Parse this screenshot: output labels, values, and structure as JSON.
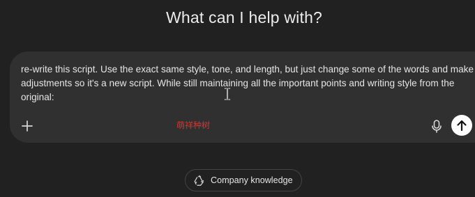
{
  "header": {
    "title": "What can I help with?"
  },
  "composer": {
    "text": "re-write this script. Use the exact same style, tone, and length, but just change some of the words and make adjustments so it's a new script. While still maintaining all the important points and writing style from the original:",
    "attach_icon": "plus-icon",
    "voice_icon": "microphone-icon",
    "send_icon": "arrow-up-icon"
  },
  "watermark": {
    "text": "萌祥种树",
    "color": "#d9332b"
  },
  "suggestion": {
    "label": "Company knowledge",
    "icon": "recycle-icon"
  },
  "colors": {
    "background": "#212121",
    "composer": "#303030",
    "send_button": "#ffffff"
  }
}
